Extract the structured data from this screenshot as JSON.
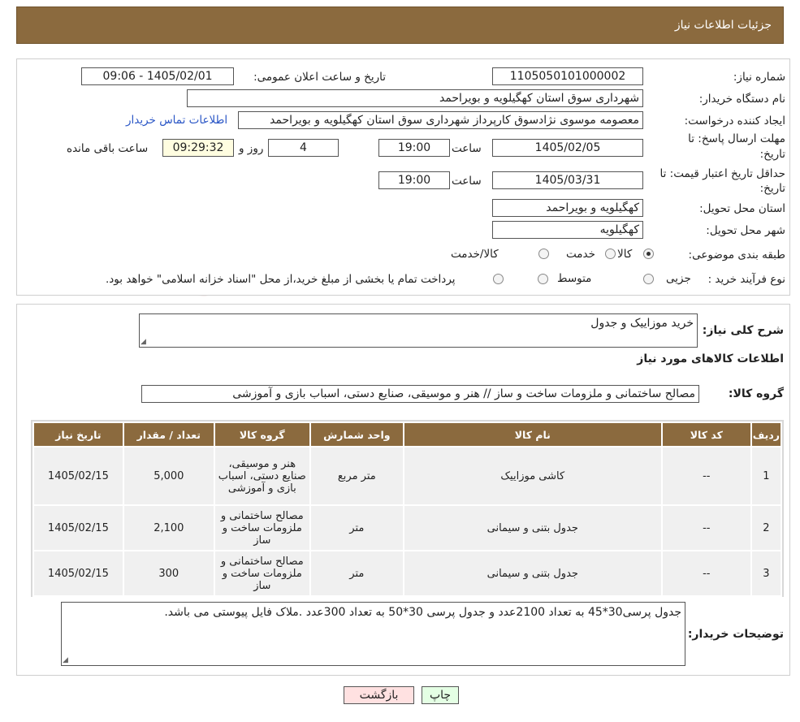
{
  "header": {
    "title": "جزئیات اطلاعات نیاز"
  },
  "info": {
    "need_number_label": "شماره نیاز:",
    "need_number": "1105050101000002",
    "announce_label": "تاریخ و ساعت اعلان عمومی:",
    "announce_value": "1405/02/01 - 09:06",
    "buyer_org_label": "نام دستگاه خریدار:",
    "buyer_org": "شهرداری سوق استان کهگیلویه و بویراحمد",
    "requester_label": "ایجاد کننده درخواست:",
    "requester": "معصومه موسوی نژادسوق کارپرداز شهرداری سوق استان کهگیلویه و بویراحمد",
    "contact_link": "اطلاعات تماس خریدار",
    "deadline_label_1": "مهلت ارسال پاسخ: تا",
    "deadline_label_2": "تاریخ:",
    "deadline_date": "1405/02/05",
    "time_label": "ساعت",
    "deadline_time": "19:00",
    "days_value": "4",
    "days_label": "روز و",
    "remaining_time": "09:29:32",
    "remaining_label": "ساعت باقی مانده",
    "validity_label_1": "حداقل تاریخ اعتبار قیمت: تا",
    "validity_label_2": "تاریخ:",
    "validity_date": "1405/03/31",
    "validity_time": "19:00",
    "province_label": "استان محل تحویل:",
    "province": "کهگیلویه و بویراحمد",
    "city_label": "شهر محل تحویل:",
    "city": "کهگیلویه",
    "category_label": "طبقه بندی موضوعی:",
    "category_options": [
      "کالا",
      "خدمت",
      "کالا/خدمت"
    ],
    "category_selected": "کالا",
    "process_label": "نوع فرآیند خرید :",
    "process_options": [
      "جزیی",
      "متوسط"
    ],
    "payment_note": "پرداخت تمام یا بخشی از مبلغ خرید،از محل \"اسناد خزانه اسلامی\" خواهد بود."
  },
  "details": {
    "summary_label": "شرح کلی نیاز:",
    "summary_value": "خرید موزاییک و جدول",
    "goods_title": "اطلاعات کالاهای مورد نیاز",
    "goods_group_label": "گروه کالا:",
    "goods_group_value": "مصالح ساختمانی و ملزومات ساخت و ساز // هنر و موسیقی، صنایع دستی، اسباب بازی و آموزشی",
    "table": {
      "headers": [
        "ردیف",
        "کد کالا",
        "نام کالا",
        "واحد شمارش",
        "گروه کالا",
        "تعداد / مقدار",
        "تاریخ نیاز"
      ],
      "rows": [
        [
          "1",
          "--",
          "کاشی موزاییک",
          "متر مربع",
          "هنر و موسیقی، صنایع دستی، اسباب بازی و آموزشی",
          "5,000",
          "1405/02/15"
        ],
        [
          "2",
          "--",
          "جدول بتنی و سیمانی",
          "متر",
          "مصالح ساختمانی و ملزومات ساخت و ساز",
          "2,100",
          "1405/02/15"
        ],
        [
          "3",
          "--",
          "جدول بتنی و سیمانی",
          "متر",
          "مصالح ساختمانی و ملزومات ساخت و ساز",
          "300",
          "1405/02/15"
        ]
      ]
    },
    "buyer_notes_label": "توضیحات خریدار:",
    "buyer_notes_value": "جدول پرسی30*45 به تعداد 2100عدد و جدول پرسی 30*50 به تعداد 300عدد .ملاک فایل پیوستی می باشد."
  },
  "buttons": {
    "print": "چاپ",
    "back": "بازگشت"
  },
  "colors": {
    "header": "#8b6a3e",
    "time_box": "#fffde0",
    "back_button": "#ffe1e1",
    "print_button": "#e4ffe4",
    "link": "#2a56c6"
  }
}
